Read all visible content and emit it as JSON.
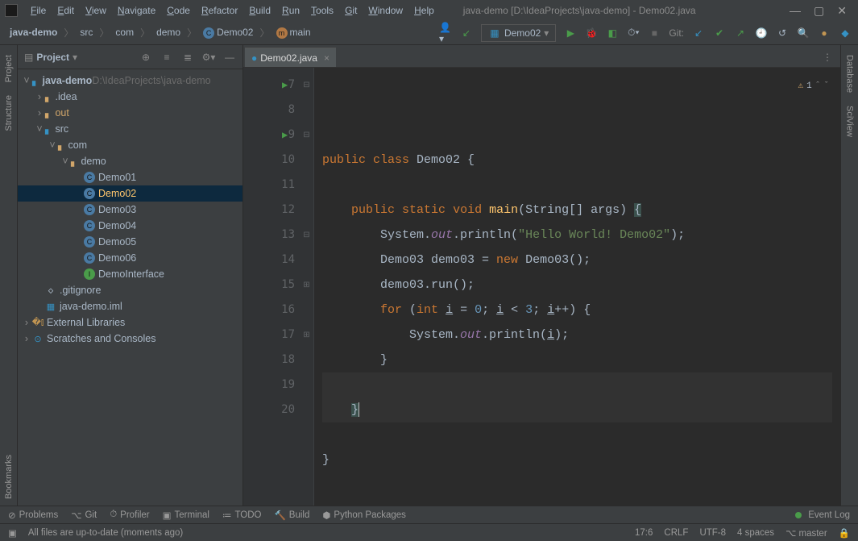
{
  "title": "java-demo [D:\\IdeaProjects\\java-demo] - Demo02.java",
  "menu": [
    "File",
    "Edit",
    "View",
    "Navigate",
    "Code",
    "Refactor",
    "Build",
    "Run",
    "Tools",
    "Git",
    "Window",
    "Help"
  ],
  "breadcrumbs": [
    "java-demo",
    "src",
    "com",
    "demo",
    "Demo02",
    "main"
  ],
  "runConfig": "Demo02",
  "navGitLabel": "Git:",
  "projectPanel": {
    "title": "Project"
  },
  "tree": {
    "root": {
      "name": "java-demo",
      "path": "D:\\IdeaProjects\\java-demo"
    },
    "idea": ".idea",
    "out": "out",
    "src": "src",
    "com": "com",
    "demo": "demo",
    "classes": [
      "Demo01",
      "Demo02",
      "Demo03",
      "Demo04",
      "Demo05",
      "Demo06",
      "DemoInterface"
    ],
    "gitignore": ".gitignore",
    "iml": "java-demo.iml",
    "extLib": "External Libraries",
    "scratches": "Scratches and Consoles"
  },
  "tab": {
    "name": "Demo02.java"
  },
  "code": {
    "lines": [
      {
        "n": 7,
        "run": true,
        "fold": "⊟",
        "html": "<span class='kw'>public</span> <span class='kw'>class</span> Demo02 {"
      },
      {
        "n": 8,
        "html": ""
      },
      {
        "n": 9,
        "run": true,
        "fold": "⊟",
        "html": "    <span class='kw'>public</span> <span class='kw'>static</span> <span class='kw'>void</span> <span class='fn'>main</span>(String[] args) <span class='hl-brace'>{</span>"
      },
      {
        "n": 10,
        "html": "        System.<span class='fld'>out</span>.println(<span class='str'>\"Hello World! Demo02\"</span>);"
      },
      {
        "n": 11,
        "html": "        Demo03 demo03 = <span class='kw'>new</span> Demo03();"
      },
      {
        "n": 12,
        "html": "        demo03.run();"
      },
      {
        "n": 13,
        "fold": "⊟",
        "html": "        <span class='kw'>for</span> (<span class='kw'>int</span> <u>i</u> = <span class='num'>0</span>; <u>i</u> &lt; <span class='num'>3</span>; <u>i</u>++) {"
      },
      {
        "n": 14,
        "html": "            System.<span class='fld'>out</span>.println(<u>i</u>);"
      },
      {
        "n": 15,
        "fold": "⊞",
        "html": "        }"
      },
      {
        "n": 16,
        "caret": true,
        "html": ""
      },
      {
        "n": 17,
        "fold": "⊞",
        "caret": true,
        "html": "    <span class='hl-brace'>}</span><span class='cursor-bar'></span>"
      },
      {
        "n": 18,
        "html": ""
      },
      {
        "n": 19,
        "html": "}"
      },
      {
        "n": 20,
        "html": ""
      }
    ],
    "warnCount": "1"
  },
  "leftStripe": [
    "Project",
    "Structure",
    "Bookmarks"
  ],
  "rightStripe": [
    "Database",
    "SciView"
  ],
  "bottomTools": [
    "Problems",
    "Git",
    "Profiler",
    "Terminal",
    "TODO",
    "Build",
    "Python Packages"
  ],
  "eventLog": "Event Log",
  "status": {
    "msg": "All files are up-to-date (moments ago)",
    "pos": "17:6",
    "eol": "CRLF",
    "enc": "UTF-8",
    "indent": "4 spaces",
    "branch": "master"
  }
}
